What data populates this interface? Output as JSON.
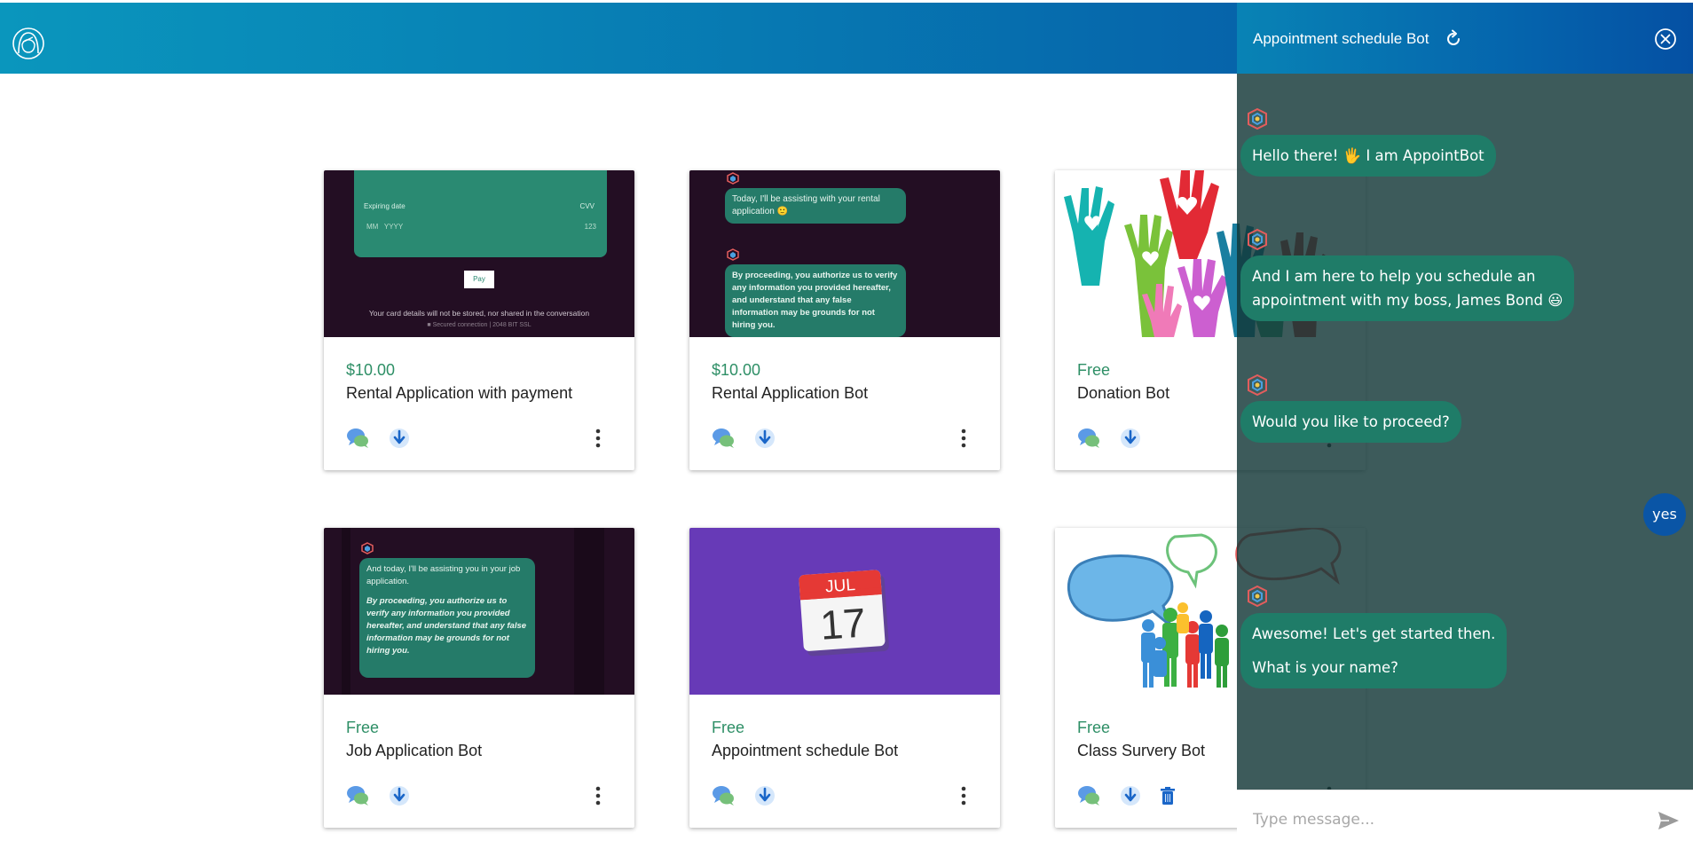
{
  "colors": {
    "header_gradient_start": "#0a96bd",
    "header_gradient_end": "#0550a3",
    "price_green": "#2e8f66",
    "bot_bubble": "#1f7c68",
    "user_bubble": "#0a55a6",
    "panel_overlay": "#123737"
  },
  "cards": [
    {
      "price": "$10.00",
      "title": "Rental Application with payment",
      "thumb": {
        "expiring_label": "Expiring date",
        "cvv_label": "CVV",
        "date_placeholder": "MM   YYYY",
        "cvv_value": "123",
        "pay_label": "Pay",
        "notice": "Your card details will not be stored, nor shared in the conversation",
        "secure": "Secured connection | 2048 BIT SSL"
      }
    },
    {
      "price": "$10.00",
      "title": "Rental Application Bot",
      "thumb": {
        "msg1": "Today, I'll be assisting with your rental application 🙂",
        "msg2": "By proceeding, you authorize us to verify any information you provided hereafter, and understand that any false information may be grounds for not hiring you."
      }
    },
    {
      "price": "Free",
      "title": "Donation Bot"
    },
    {
      "price": "Free",
      "title": "Job Application Bot",
      "thumb": {
        "msg1": "And today, I'll be assisting you in your job application.",
        "msg2": "By proceeding, you authorize us to verify any information you provided hereafter, and understand that any false information may be grounds for not hiring you."
      }
    },
    {
      "price": "Free",
      "title": "Appointment schedule Bot",
      "thumb": {
        "month": "JUL",
        "day": "17"
      }
    },
    {
      "price": "Free",
      "title": "Class Survery Bot"
    }
  ],
  "chat": {
    "title": "Appointment schedule Bot",
    "messages": [
      {
        "from": "bot",
        "text": "Hello there! 🖐 I am AppointBot"
      },
      {
        "from": "bot",
        "line1": "And I am here to help you schedule an",
        "line2": "appointment with my boss, James Bond 😃"
      },
      {
        "from": "bot",
        "text": "Would you like to proceed?"
      },
      {
        "from": "user",
        "text": "yes"
      },
      {
        "from": "bot",
        "line1": "Awesome! Let's get started then.",
        "line2": "What is your name?"
      }
    ],
    "input_placeholder": "Type message..."
  },
  "icons": {
    "logo": "woman-avatar-icon",
    "card_actions": [
      "chat-bubbles-icon",
      "download-icon",
      "trash-icon",
      "more-vertical-icon"
    ],
    "chat_header": [
      "refresh-icon",
      "close-icon"
    ],
    "composer": [
      "send-icon"
    ]
  }
}
